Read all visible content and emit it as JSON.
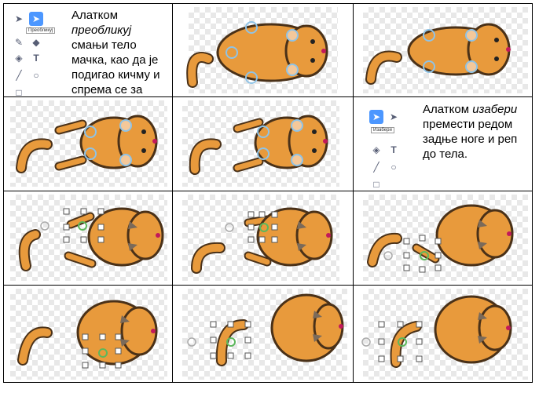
{
  "cells": {
    "c1_caption": {
      "line1": "Алатком",
      "tool_name": "преобликуј",
      "rest": "смањи тело мачка, као да је подигао кичму и спрема се за скок."
    },
    "c1_tooltip": "Преобликуј",
    "c6_caption": {
      "line1": "Алатком",
      "tool_name": "изабери",
      "rest": "премести редом задње ноге и реп до тела."
    },
    "c6_tooltip": "Изабери"
  },
  "toolbar_icons": [
    "select-arrow-icon",
    "reshape-arrow-icon",
    "brush-icon",
    "eraser-icon",
    "fill-icon",
    "text-icon",
    "line-icon",
    "circle-icon",
    "rectangle-icon"
  ],
  "colors": {
    "cat_body": "#e89a3c",
    "cat_outline": "#4a3118",
    "handle_blue": "#8fc3e6",
    "handle_green": "#5cb85c",
    "tool_selected": "#4c97ff",
    "nose": "#c2185b"
  }
}
